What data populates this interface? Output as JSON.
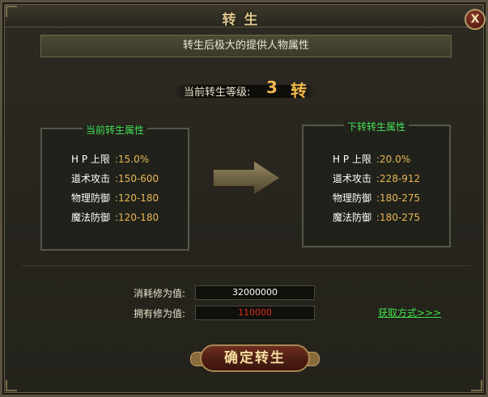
{
  "window": {
    "title": "转生",
    "close_label": "X"
  },
  "banner": "转生后极大的提供人物属性",
  "level": {
    "label": "当前转生等级:",
    "value": "3",
    "unit": "转"
  },
  "current": {
    "title": "当前转生属性",
    "attrs": [
      {
        "label": "H P 上限",
        "value": ":15.0%"
      },
      {
        "label": "道术攻击",
        "value": ":150-600"
      },
      {
        "label": "物理防御",
        "value": ":120-180"
      },
      {
        "label": "魔法防御",
        "value": ":120-180"
      }
    ]
  },
  "next": {
    "title": "下转转生属性",
    "attrs": [
      {
        "label": "H P 上限",
        "value": ":20.0%"
      },
      {
        "label": "道术攻击",
        "value": ":228-912"
      },
      {
        "label": "物理防御",
        "value": ":180-275"
      },
      {
        "label": "魔法防御",
        "value": ":180-275"
      }
    ]
  },
  "cost": {
    "consume_label": "消耗修为值:",
    "consume_value": "32000000",
    "own_label": "拥有修为值:",
    "own_value": "110000",
    "own_color": "#e02a1a",
    "consume_color": "#ffffff"
  },
  "link": "获取方式>>>",
  "confirm": "确定转生",
  "icons": {
    "close": "close-icon",
    "arrow": "right-arrow-icon"
  }
}
